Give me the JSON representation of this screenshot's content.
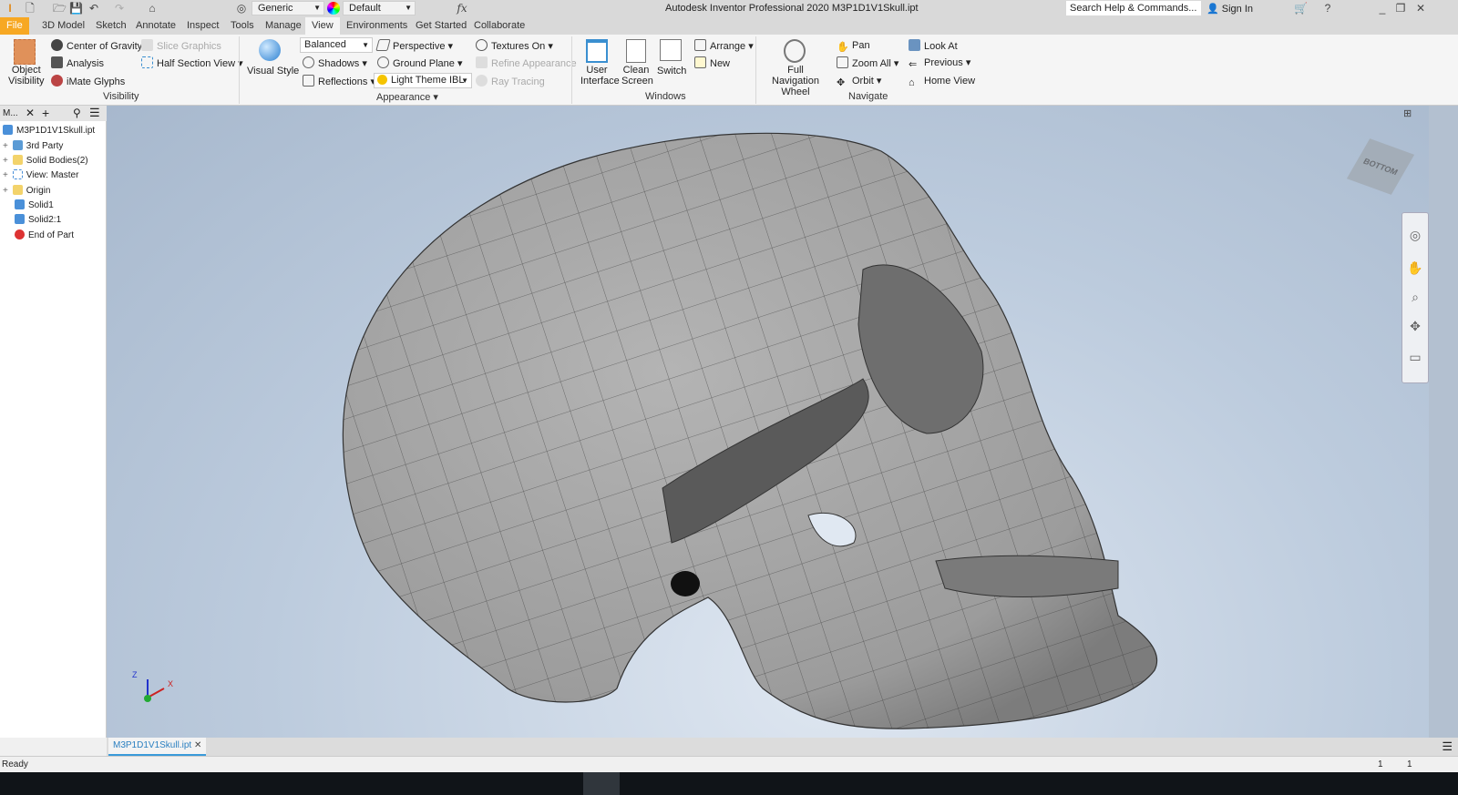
{
  "title": "Autodesk Inventor Professional 2020   M3P1D1V1Skull.ipt",
  "qat": {
    "material": "Generic",
    "appearance": "Default",
    "search_placeholder": "Search Help & Commands...",
    "sign_in": "Sign In"
  },
  "tabs": [
    "File",
    "3D Model",
    "Sketch",
    "Annotate",
    "Inspect",
    "Tools",
    "Manage",
    "View",
    "Environments",
    "Get Started",
    "Collaborate"
  ],
  "ribbon": {
    "visibility": {
      "object_visibility": "Object\nVisibility",
      "center_gravity": "Center of Gravity",
      "analysis": "Analysis",
      "imate": "iMate Glyphs",
      "slice": "Slice Graphics",
      "half_section": "Half Section View",
      "label": "Visibility"
    },
    "appearance": {
      "visual_style": "Visual Style",
      "balanced": "Balanced",
      "shadows": "Shadows",
      "reflections": "Reflections",
      "perspective": "Perspective",
      "ground_plane": "Ground Plane",
      "ibl": "Light Theme IBL",
      "textures": "Textures On",
      "refine": "Refine Appearance",
      "ray": "Ray Tracing",
      "label": "Appearance"
    },
    "windows": {
      "user_interface": "User Interface",
      "clean_screen": "Clean Screen",
      "switch": "Switch",
      "arrange": "Arrange",
      "new": "New",
      "label": "Windows"
    },
    "navigate": {
      "wheel": "Full Navigation Wheel",
      "pan": "Pan",
      "zoom_all": "Zoom All",
      "orbit": "Orbit",
      "look_at": "Look At",
      "previous": "Previous",
      "home_view": "Home View",
      "label": "Navigate"
    }
  },
  "browser": {
    "tab": "M...",
    "root": "M3P1D1V1Skull.ipt",
    "items": [
      "3rd Party",
      "Solid Bodies(2)",
      "View: Master",
      "Origin",
      "Solid1",
      "Solid2:1",
      "End of Part"
    ]
  },
  "viewcube": "BOTTOM",
  "triad": {
    "z": "Z",
    "x": "X"
  },
  "doc_tab": "M3P1D1V1Skull.ipt",
  "status": {
    "text": "Ready",
    "n1": "1",
    "n2": "1"
  }
}
